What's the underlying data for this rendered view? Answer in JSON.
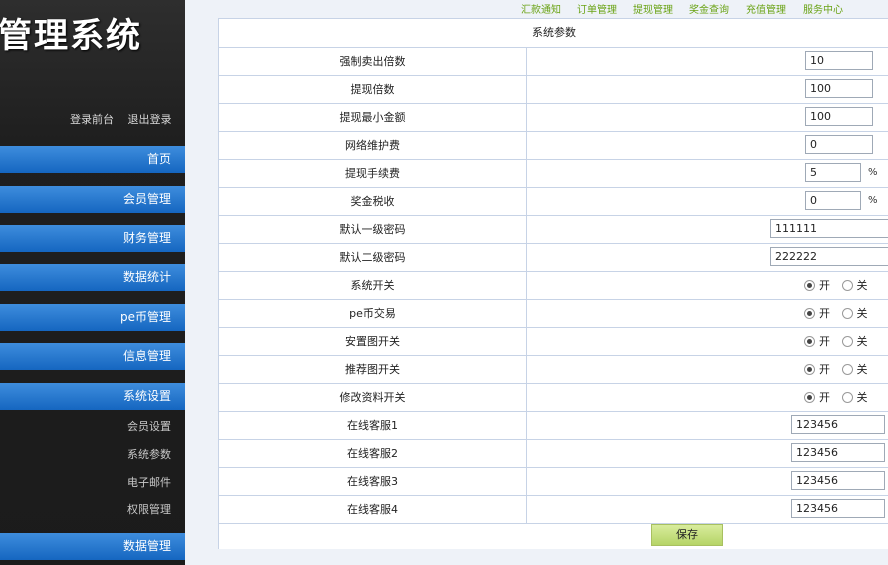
{
  "sidebar": {
    "title": "管理系统",
    "user_links": [
      "登录前台",
      "退出登录"
    ],
    "menu": [
      {
        "label": "首页"
      },
      {
        "label": "会员管理"
      },
      {
        "label": "财务管理"
      },
      {
        "label": "数据统计"
      },
      {
        "label": "pe币管理"
      },
      {
        "label": "信息管理"
      },
      {
        "label": "系统设置"
      }
    ],
    "submenu": [
      "会员设置",
      "系统参数",
      "电子邮件",
      "权限管理"
    ],
    "last_menu": "数据管理"
  },
  "top_nav": [
    "汇款通知",
    "订单管理",
    "提现管理",
    "奖金查询",
    "充值管理",
    "服务中心"
  ],
  "panel": {
    "title": "系统参数",
    "rows": [
      {
        "label": "强制卖出倍数",
        "value": "10"
      },
      {
        "label": "提现倍数",
        "value": "100"
      },
      {
        "label": "提现最小金额",
        "value": "100"
      },
      {
        "label": "网络维护费",
        "value": "0"
      },
      {
        "label": "提现手续费",
        "value": "5",
        "unit": "%"
      },
      {
        "label": "奖金税收",
        "value": "0",
        "unit": "%"
      },
      {
        "label": "默认一级密码",
        "value": "111111"
      },
      {
        "label": "默认二级密码",
        "value": "222222"
      },
      {
        "label": "系统开关",
        "on": "开",
        "off": "关",
        "selected": "开"
      },
      {
        "label": "pe币交易",
        "on": "开",
        "off": "关",
        "selected": "开"
      },
      {
        "label": "安置图开关",
        "on": "开",
        "off": "关",
        "selected": "开"
      },
      {
        "label": "推荐图开关",
        "on": "开",
        "off": "关",
        "selected": "开"
      },
      {
        "label": "修改资料开关",
        "on": "开",
        "off": "关",
        "selected": "开"
      },
      {
        "label": "在线客服1",
        "value": "123456"
      },
      {
        "label": "在线客服2",
        "value": "123456"
      },
      {
        "label": "在线客服3",
        "value": "123456"
      },
      {
        "label": "在线客服4",
        "value": "123456"
      }
    ],
    "save_label": "保存"
  },
  "colors": {
    "sidebar_bg": "#1f1f1f",
    "menu_blue": "#1566c0",
    "nav_green": "#6aa315",
    "border": "#c7d3e6",
    "save_green": "#b5d467"
  }
}
